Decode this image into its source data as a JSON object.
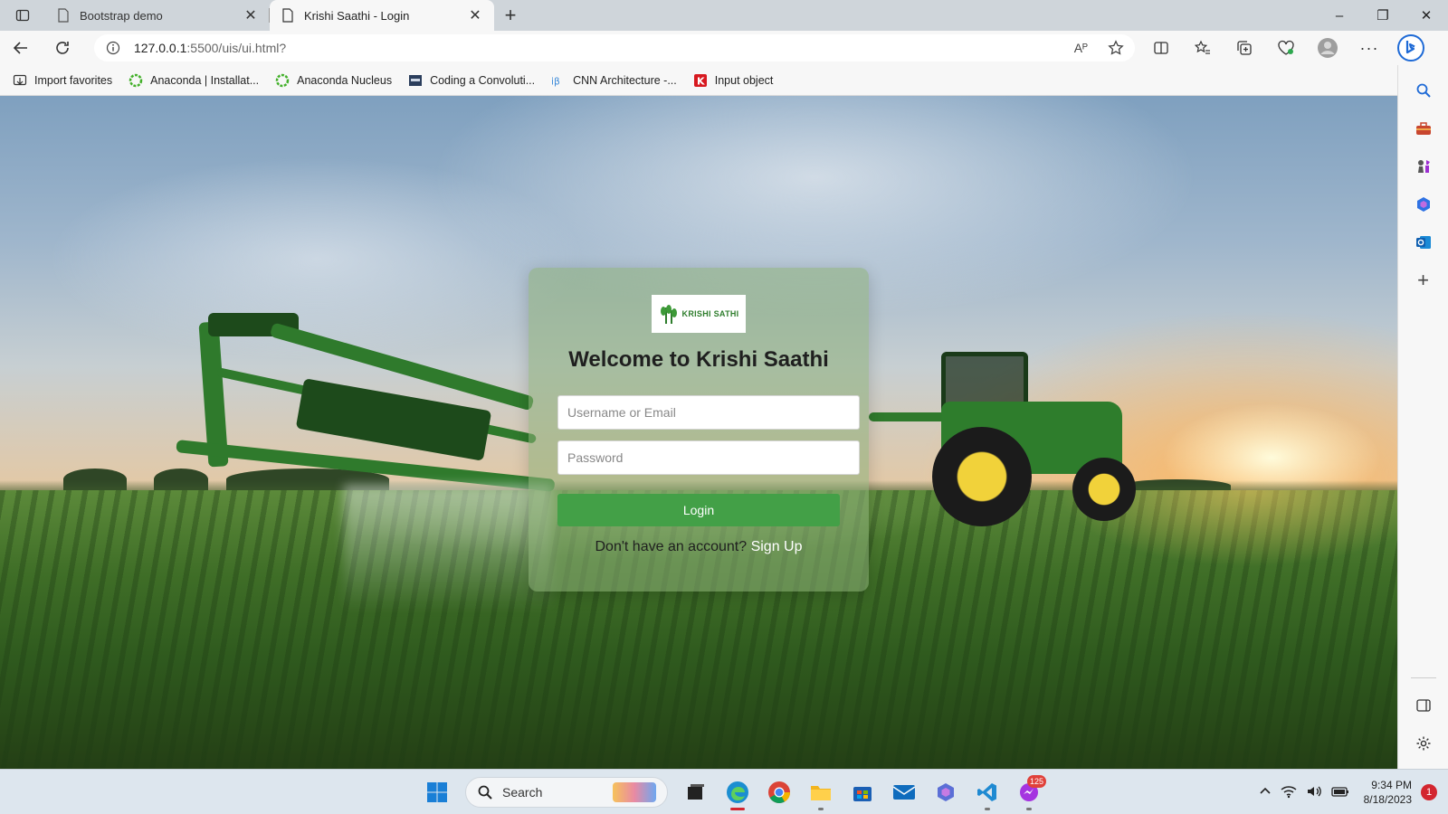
{
  "browser": {
    "tabs": [
      {
        "title": "Bootstrap demo",
        "active": false
      },
      {
        "title": "Krishi Saathi - Login",
        "active": true
      }
    ],
    "url_host": "127.0.0.1",
    "url_rest": ":5500/uis/ui.html?",
    "read_aloud_label": "Aᴾ",
    "favorites": [
      {
        "label": "Import favorites",
        "icon": "import-icon"
      },
      {
        "label": "Anaconda | Installat...",
        "icon": "anaconda-icon"
      },
      {
        "label": "Anaconda Nucleus",
        "icon": "anaconda-icon"
      },
      {
        "label": "Coding a Convoluti...",
        "icon": "site-icon"
      },
      {
        "label": "CNN Architecture -...",
        "icon": "site-icon"
      },
      {
        "label": "Input object",
        "icon": "k-icon"
      }
    ]
  },
  "page": {
    "logo_text": "KRISHI SATHI",
    "heading": "Welcome to Krishi Saathi",
    "username_placeholder": "Username or Email",
    "password_placeholder": "Password",
    "login_label": "Login",
    "signup_prompt": "Don't have an account?",
    "signup_link": "Sign Up"
  },
  "taskbar": {
    "search_label": "Search",
    "time": "9:34 PM",
    "date": "8/18/2023",
    "notification_count": "1",
    "app_badge": "125"
  },
  "colors": {
    "accent_green": "#43a047",
    "brand_green": "#2e7d2c"
  }
}
